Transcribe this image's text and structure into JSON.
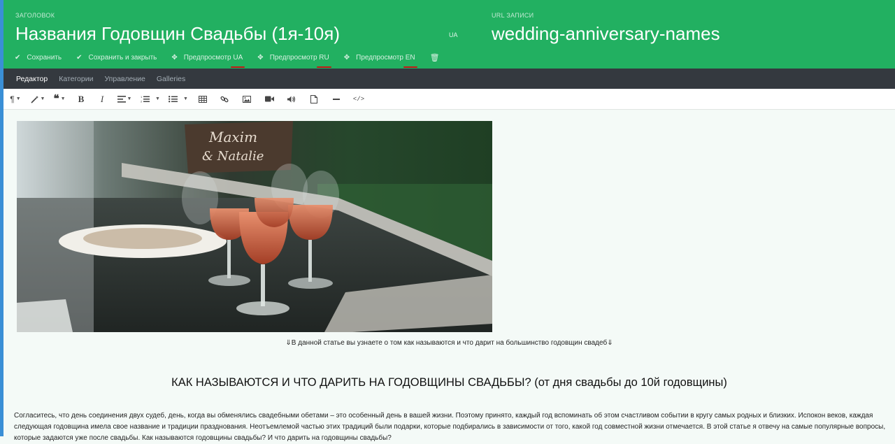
{
  "header": {
    "title_label": "ЗАГОЛОВОК",
    "title": "Названия Годовщин Свадьбы (1я-10я)",
    "lang_tag": "UA",
    "url_label": "URL ЗАПИСИ",
    "url": "wedding-anniversary-names",
    "actions": {
      "save": "Сохранить",
      "save_close": "Сохранить и закрыть",
      "preview_ua_prefix": "Предпросмотр",
      "preview_ua_lang": "UA",
      "preview_ru_prefix": "Предпросмотр",
      "preview_ru_lang": "RU",
      "preview_en_prefix": "Предпросмотр",
      "preview_en_lang": "EN"
    }
  },
  "tabs": [
    "Редактор",
    "Категории",
    "Управление",
    "Galleries"
  ],
  "toolbar_icons": [
    "paragraph-icon",
    "magic-wand-icon",
    "quote-icon",
    "bold-icon",
    "italic-icon",
    "align-icon",
    "ordered-list-icon",
    "unordered-list-icon",
    "table-icon",
    "link-icon",
    "image-icon",
    "video-icon",
    "audio-icon",
    "file-icon",
    "horizontal-rule-icon",
    "code-view-icon"
  ],
  "content": {
    "caption": "⇓В данной статье вы узнаете о том как называются и что дарит на большинство годовщин свадеб⇓",
    "heading": "КАК НАЗЫВАЮТСЯ И ЧТО ДАРИТЬ НА ГОДОВЩИНЫ СВАДЬБЫ? (от дня свадьбы до 10й годовщины)",
    "paragraph_lines": [
      "Согласитесь, что день соединения двух судеб, день, когда вы обменялись свадебными обетами – это особенный день в вашей жизни. Поэтому принято, каждый год вспоминать об этом счастливом событии в кругу самых родных и близких. Испокон веков, каждая",
      "следующая годовщина имела свое название и традиции празднования. Неотъемлемой частью этих традиций были подарки, которые подбирались в зависимости от того, какой год совместной жизни отмечается. В этой статье я отвечу на самые популярные вопросы,",
      "которые задаются уже после свадьбы. Как называются годовщины свадьбы? И что дарить на годовщины свадьбы?"
    ]
  },
  "colors": {
    "header_bg": "#22b061",
    "tabbar_bg": "#34393f",
    "accent_underline": "#c51515",
    "left_accent": "#3a8fd6"
  }
}
